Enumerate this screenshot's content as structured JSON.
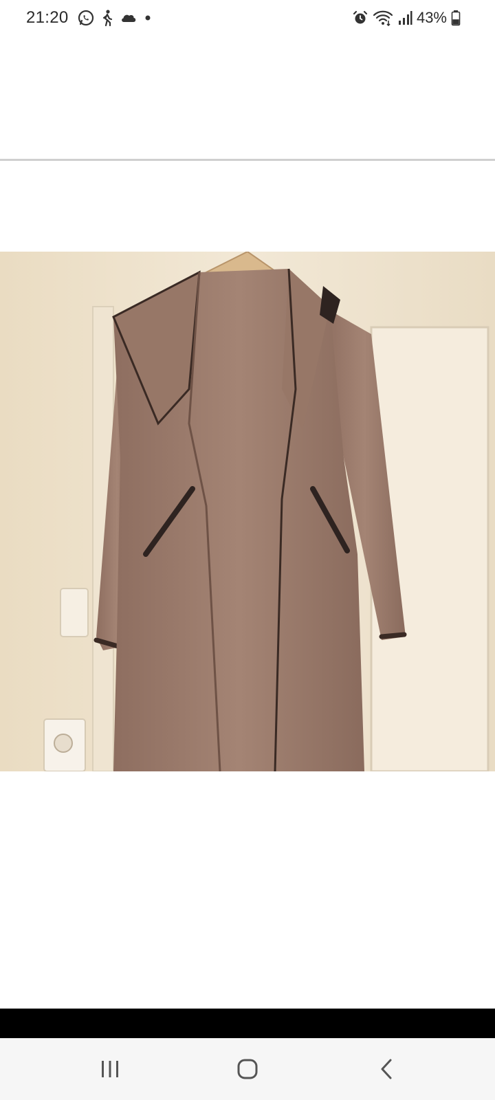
{
  "status_bar": {
    "time": "21:20",
    "left_icons": [
      "whatsapp-icon",
      "walking-icon",
      "cloud-icon",
      "dot-icon"
    ],
    "right_icons": [
      "alarm-icon",
      "wifi-icon",
      "signal-icon"
    ],
    "battery_percent": "43%",
    "battery_level": 0.43
  },
  "image": {
    "subject": "brown-hooded-long-coat-on-hanger",
    "colors": {
      "wall": "#efe3cd",
      "coat": "#9c7c6c",
      "trim": "#3a2a24",
      "door": "#f4ead9"
    }
  },
  "nav_bar": {
    "buttons": [
      "recent-apps",
      "home",
      "back"
    ]
  }
}
